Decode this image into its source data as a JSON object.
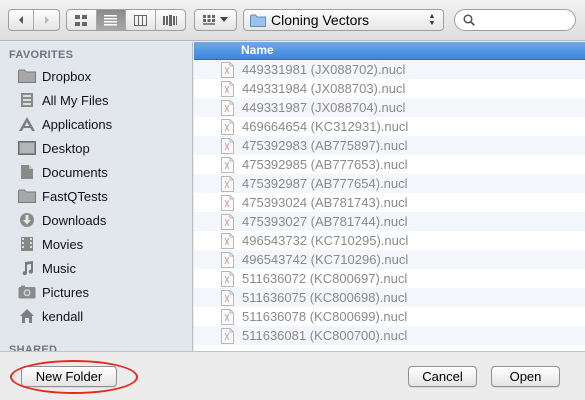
{
  "toolbar": {
    "location": "Cloning Vectors",
    "search_placeholder": ""
  },
  "sidebar": {
    "favorites_label": "FAVORITES",
    "shared_label": "SHARED",
    "items": [
      {
        "label": "Dropbox",
        "icon": "folder-icon"
      },
      {
        "label": "All My Files",
        "icon": "all-files-icon"
      },
      {
        "label": "Applications",
        "icon": "applications-icon"
      },
      {
        "label": "Desktop",
        "icon": "desktop-icon"
      },
      {
        "label": "Documents",
        "icon": "documents-icon"
      },
      {
        "label": "FastQTests",
        "icon": "folder-icon"
      },
      {
        "label": "Downloads",
        "icon": "downloads-icon"
      },
      {
        "label": "Movies",
        "icon": "movies-icon"
      },
      {
        "label": "Music",
        "icon": "music-icon"
      },
      {
        "label": "Pictures",
        "icon": "pictures-icon"
      },
      {
        "label": "kendall",
        "icon": "home-icon"
      }
    ]
  },
  "filelist": {
    "column_name": "Name",
    "files": [
      "449331981 (JX088702).nucl",
      "449331984 (JX088703).nucl",
      "449331987 (JX088704).nucl",
      "469664654 (KC312931).nucl",
      "475392983 (AB775897).nucl",
      "475392985 (AB777653).nucl",
      "475392987 (AB777654).nucl",
      "475393024 (AB781743).nucl",
      "475393027 (AB781744).nucl",
      "496543732 (KC710295).nucl",
      "496543742 (KC710296).nucl",
      "511636072 (KC800697).nucl",
      "511636075 (KC800698).nucl",
      "511636078 (KC800699).nucl",
      "511636081 (KC800700).nucl"
    ]
  },
  "buttons": {
    "new_folder": "New Folder",
    "cancel": "Cancel",
    "open": "Open"
  },
  "colors": {
    "highlight_ring": "#e52a1c",
    "header_blue": "#3d86de",
    "folder_blue": "#8db4dc"
  }
}
